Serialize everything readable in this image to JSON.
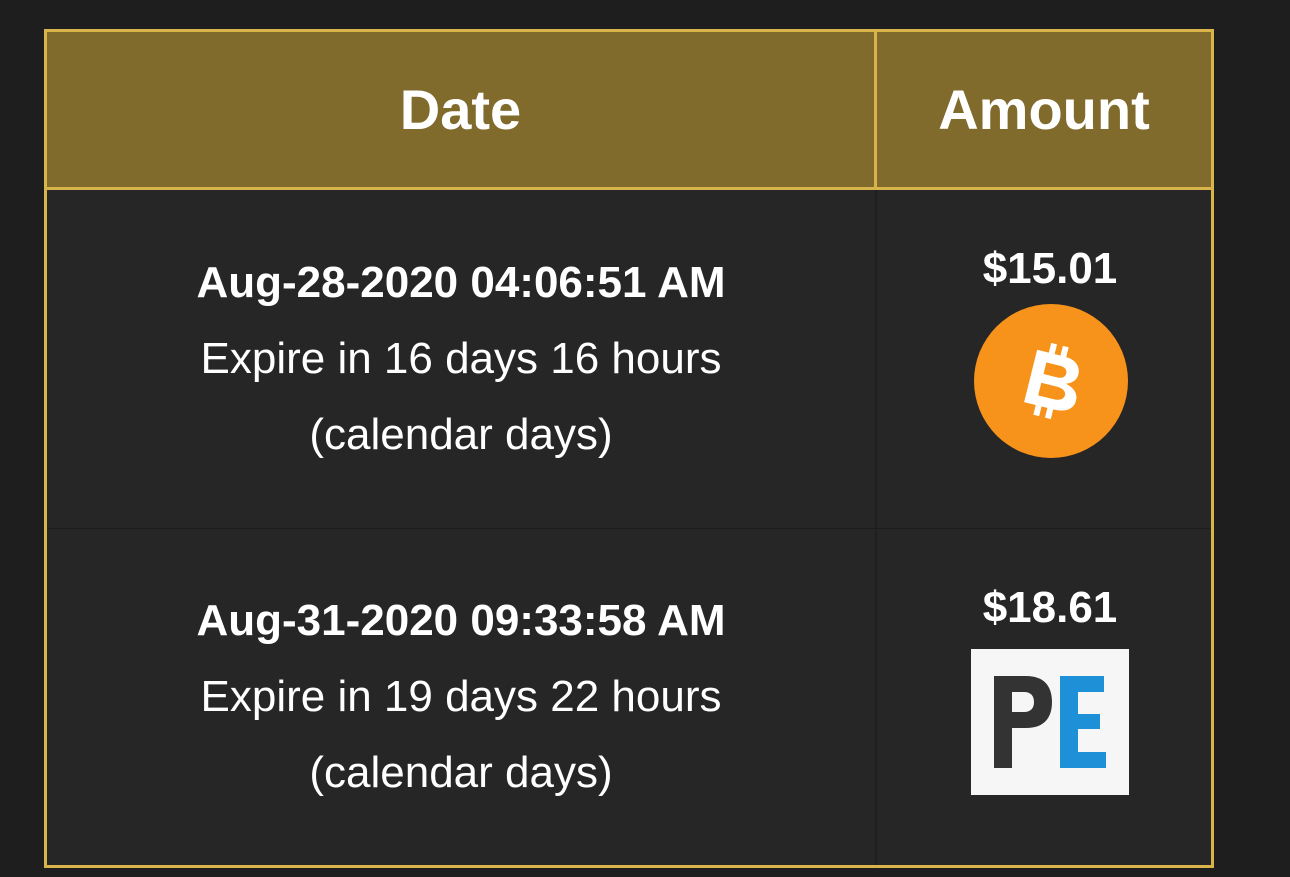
{
  "table": {
    "headers": {
      "date": "Date",
      "amount": "Amount"
    },
    "rows": [
      {
        "date": "Aug-28-2020 04:06:51 AM",
        "expire": "Expire in 16 days 16 hours",
        "note": "(calendar days)",
        "amount": "$15.01",
        "payment_icon": "bitcoin-icon"
      },
      {
        "date": "Aug-31-2020 09:33:58 AM",
        "expire": "Expire in 19 days 22 hours",
        "note": "(calendar days)",
        "amount": "$18.61",
        "payment_icon": "payeer-icon"
      }
    ]
  },
  "colors": {
    "background": "#1e1e1e",
    "header_bg": "#806a2c",
    "border": "#d9b44a",
    "row_bg": "#262626",
    "bitcoin": "#f7931a",
    "pe_dark": "#333333",
    "pe_blue": "#1e90d8"
  }
}
